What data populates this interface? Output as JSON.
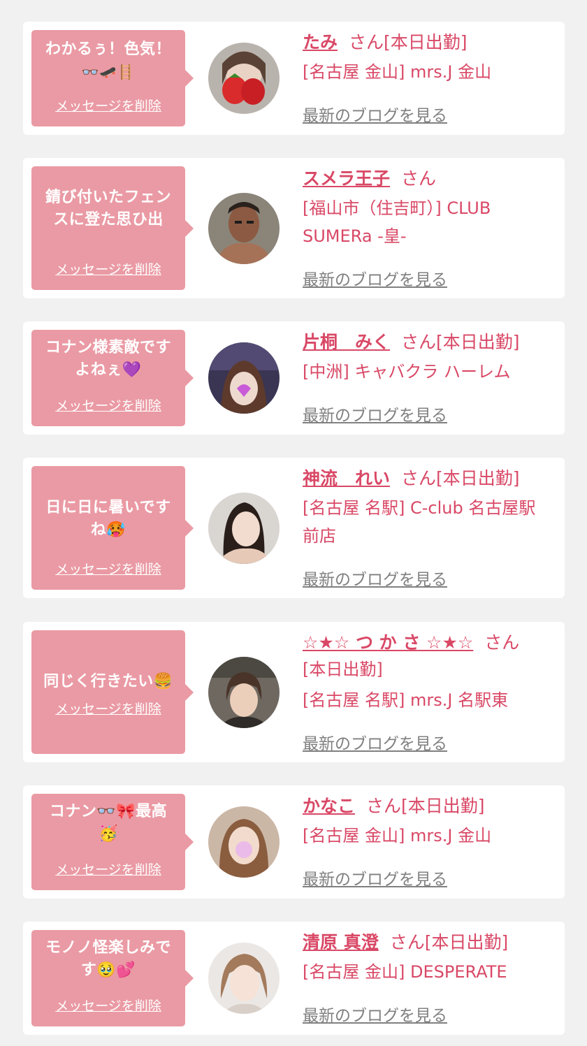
{
  "delete_label": "メッセージを削除",
  "blog_label": "最新のブログを見る",
  "colors": {
    "background": "#f1f1f1",
    "bubble": "#ea9aa4",
    "name": "#d94866",
    "link_gray": "#808080"
  },
  "cards": [
    {
      "message_line1": "わかるぅ！色気！",
      "message_line2": "👓🛹🪜",
      "name": "たみ",
      "suffix": "さん[本日出勤]",
      "shop_line1": "[名古屋 金山] mrs.J 金山",
      "shop_line2": ""
    },
    {
      "message_line1": "錆び付いたフェン",
      "message_line2": "スに登た思ひ出",
      "name": "スメラ王子",
      "suffix": "さん",
      "shop_line1": "[福山市（住吉町）] CLUB",
      "shop_line2": "SUMERa -皇-"
    },
    {
      "message_line1": "コナン様素敵です",
      "message_line2": "よねぇ💜",
      "name": "片桐　みく",
      "suffix": "さん[本日出勤]",
      "shop_line1": "[中洲] キャバクラ ハーレム",
      "shop_line2": ""
    },
    {
      "message_line1": "日に日に暑いです",
      "message_line2": "ね🥵",
      "name": "神流　れい",
      "suffix": "さん[本日出勤]",
      "shop_line1": "[名古屋 名駅] C-club 名古屋駅",
      "shop_line2": "前店"
    },
    {
      "message_line1": "同じく行きたい🍔",
      "message_line2": "",
      "name": "☆★☆ つ か さ ☆★☆",
      "suffix": "さん",
      "status_line": "[本日出勤]",
      "shop_line1": "[名古屋 名駅] mrs.J 名駅東",
      "shop_line2": ""
    },
    {
      "message_line1": "コナン👓🎀最高",
      "message_line2": "🥳",
      "name": "かなこ",
      "suffix": "さん[本日出勤]",
      "shop_line1": "[名古屋 金山] mrs.J 金山",
      "shop_line2": ""
    },
    {
      "message_line1": "モノノ怪楽しみで",
      "message_line2": "す🥹💕",
      "name": "清原 真澄",
      "suffix": "さん[本日出勤]",
      "shop_line1": "[名古屋 金山] DESPERATE",
      "shop_line2": ""
    }
  ]
}
